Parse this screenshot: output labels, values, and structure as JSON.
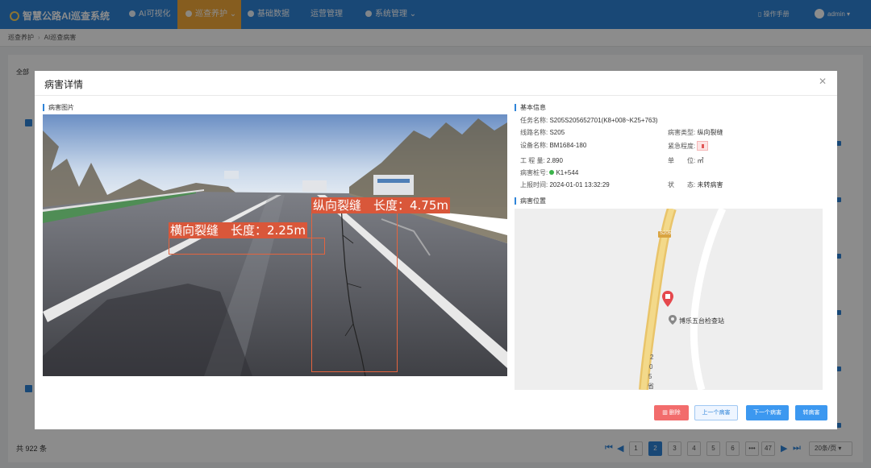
{
  "topbar": {
    "app_title": "智慧公路AI巡查系统",
    "nav": [
      {
        "label": "AI可视化"
      },
      {
        "label": "巡查养护",
        "active": true
      },
      {
        "label": "基础数据"
      },
      {
        "label": "运营管理"
      },
      {
        "label": "系统管理"
      }
    ],
    "manual_label": "操作手册",
    "user_label": "admin",
    "accent_color": "#2f84d8",
    "active_color": "#f4a93a"
  },
  "breadcrumb": {
    "items": [
      "巡查养护",
      "AI巡查病害"
    ]
  },
  "background": {
    "tab_all": "全部",
    "total_text": "共 922 条",
    "pagination": {
      "pages": [
        "1",
        "2",
        "3",
        "4",
        "5",
        "6",
        "•••",
        "47"
      ],
      "current": "2",
      "page_size": "20条/页"
    }
  },
  "modal": {
    "title": "病害详情",
    "close_icon": "close-icon",
    "image_section_title": "病害图片",
    "detections": [
      {
        "label": "横向裂缝　长度：2.25m"
      },
      {
        "label": "纵向裂缝　长度：4.75m"
      }
    ],
    "info_section_title": "基本信息",
    "info": {
      "task_name_key": "任务名称:",
      "task_name": "S205S205652701(K8+008~K25+763)",
      "route_key": "线路名称:",
      "route": "S205",
      "disease_type_key": "病害类型:",
      "disease_type": "纵向裂缝",
      "device_key": "设备名称:",
      "device": "BM1684-180",
      "urgency_key": "紧急程度:",
      "quantity_key": "工 程 量:",
      "quantity": "2.890",
      "unit_key": "单　　位:",
      "unit": "㎡",
      "stake_key": "病害桩号:",
      "stake": "K1+544",
      "report_time_key": "上报时间:",
      "report_time": "2024-01-01 13:32:29",
      "status_key": "状　　态:",
      "status": "未转病害"
    },
    "location_section_title": "病害位置",
    "map": {
      "poi_label": "博乐五台检查站",
      "road_shield": "S205",
      "road_label_chars": [
        "2",
        "0",
        "5",
        "省"
      ]
    },
    "buttons": {
      "delete": "删除",
      "prev": "上一个病害",
      "next": "下一个病害",
      "convert": "转病害"
    }
  }
}
